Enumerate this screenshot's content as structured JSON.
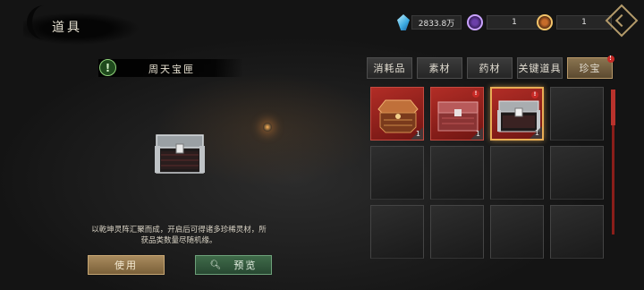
{
  "header": {
    "title": "道具",
    "back_icon": "diamond-back-icon"
  },
  "currencies": [
    {
      "icon": "crystal-icon",
      "value": "2833.8万"
    },
    {
      "icon": "purple-orb-icon",
      "value": "1"
    },
    {
      "icon": "gold-orb-icon",
      "value": "1"
    }
  ],
  "detail": {
    "item_name": "周天宝匣",
    "alert_icon": "!",
    "description": "以乾坤灵阵汇聚而成，开启后可得诸多珍稀灵材，所获品类数量尽随机缘。",
    "use_label": "使用",
    "preview_label": "预览",
    "preview_icon": "search-icon"
  },
  "tabs": [
    {
      "label": "消耗品",
      "active": false,
      "badge": false
    },
    {
      "label": "素材",
      "active": false,
      "badge": false
    },
    {
      "label": "药材",
      "active": false,
      "badge": false
    },
    {
      "label": "关键道具",
      "active": false,
      "badge": false
    },
    {
      "label": "珍宝",
      "active": true,
      "badge": true,
      "badge_text": "!"
    }
  ],
  "inventory": {
    "slots": [
      {
        "item": "octagonal-chest",
        "qty": "1",
        "badge": false,
        "selected": false
      },
      {
        "item": "red-chest",
        "qty": "1",
        "badge": true,
        "badge_text": "!",
        "selected": false
      },
      {
        "item": "silver-chest",
        "qty": "1",
        "badge": true,
        "badge_text": "!",
        "selected": true
      },
      {
        "item": null
      },
      {
        "item": null
      },
      {
        "item": null
      },
      {
        "item": null
      },
      {
        "item": null
      },
      {
        "item": null
      },
      {
        "item": null
      },
      {
        "item": null
      },
      {
        "item": null
      }
    ]
  },
  "colors": {
    "accent_gold": "#e8ad55",
    "slot_red": "#b22d26",
    "use_button": "#a98b5e",
    "preview_button": "#3f6b49",
    "badge_red": "#c82a26"
  }
}
